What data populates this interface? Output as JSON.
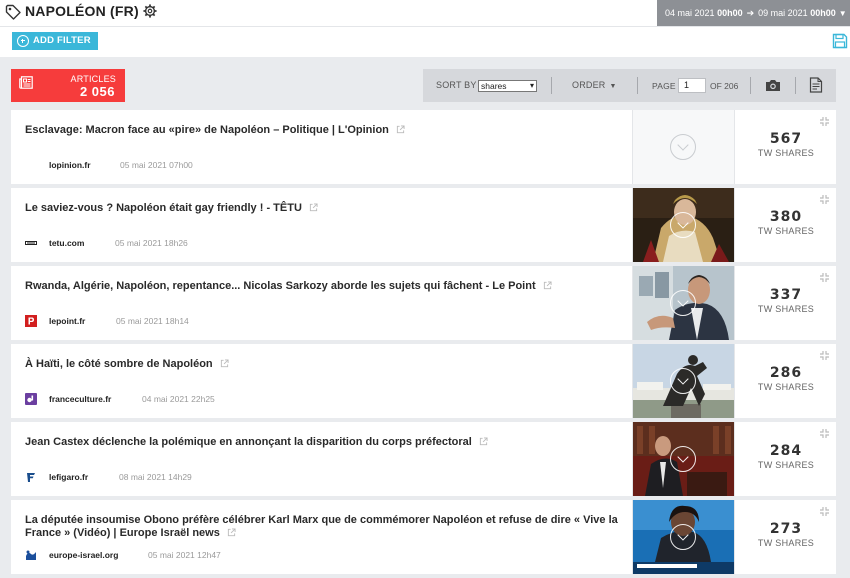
{
  "header": {
    "title": "NAPOLÉON (FR)",
    "date_from_day": "04 mai 2021",
    "date_from_time": "00h00",
    "date_to_day": "09 mai 2021",
    "date_to_time": "00h00"
  },
  "filters": {
    "add_filter_label": "ADD FILTER"
  },
  "summary": {
    "articles_label": "ARTICLES",
    "articles_count": "2 056"
  },
  "toolbar": {
    "sort_by_label": "SORT BY",
    "sort_value": "shares",
    "order_label": "ORDER",
    "page_label": "PAGE",
    "page_value": "1",
    "of_pages": "OF 206"
  },
  "colors": {
    "accent": "#3ab7d9",
    "articles_bg": "#f63c3c",
    "date_bg": "#8d9095"
  },
  "articles": [
    {
      "title": "Esclavage: Macron face au «pire» de Napoléon – Politique | L'Opinion",
      "source": "lopinion.fr",
      "date": "05 mai 2021 07h00",
      "shares": "567",
      "shares_label": "TW SHARES",
      "source_icon": "none",
      "thumb": "none"
    },
    {
      "title": "Le saviez-vous ? Napoléon était gay friendly ! - TÊTU",
      "source": "tetu.com",
      "date": "05 mai 2021 18h26",
      "shares": "380",
      "shares_label": "TW SHARES",
      "source_icon": "tetu-logo-icon",
      "thumb": "napoleon-portrait-photo"
    },
    {
      "title": "Rwanda, Algérie, Napoléon, repentance... Nicolas Sarkozy aborde les sujets qui fâchent - Le Point",
      "source": "lepoint.fr",
      "date": "05 mai 2021 18h14",
      "shares": "337",
      "shares_label": "TW SHARES",
      "source_icon": "lepoint-logo-icon",
      "thumb": "sarkozy-interview-photo"
    },
    {
      "title": "À Haïti, le côté sombre de Napoléon",
      "source": "franceculture.fr",
      "date": "04 mai 2021 22h25",
      "shares": "286",
      "shares_label": "TW SHARES",
      "source_icon": "franceculture-logo-icon",
      "thumb": "haiti-statue-photo"
    },
    {
      "title": "Jean Castex déclenche la polémique en annonçant la disparition du corps préfectoral",
      "source": "lefigaro.fr",
      "date": "08 mai 2021 14h29",
      "shares": "284",
      "shares_label": "TW SHARES",
      "source_icon": "lefigaro-logo-icon",
      "thumb": "castex-assembly-photo"
    },
    {
      "title": "La députée insoumise Obono préfère célébrer Karl Marx que de commémorer Napoléon et refuse de dire « Vive la France » (Vidéo) | Europe Israël news",
      "source": "europe-israel.org",
      "date": "05 mai 2021 12h47",
      "shares": "273",
      "shares_label": "TW SHARES",
      "source_icon": "europe-israel-logo-icon",
      "thumb": "obono-tv-photo"
    }
  ]
}
